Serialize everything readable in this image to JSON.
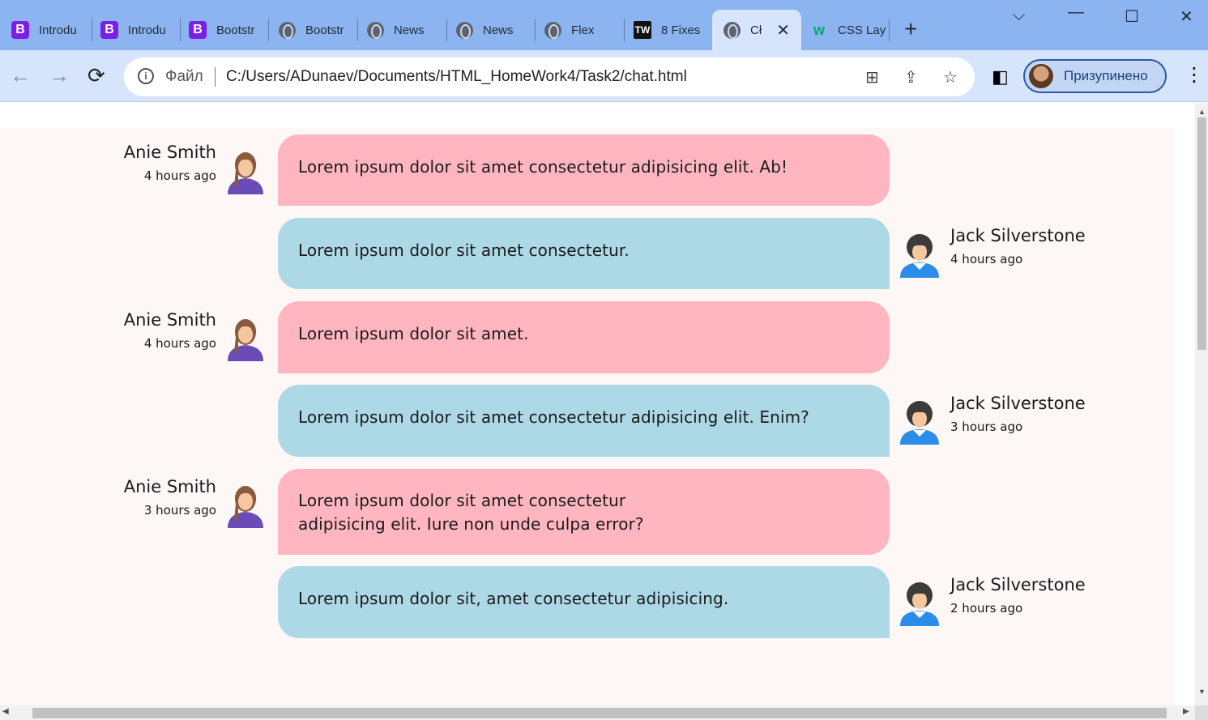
{
  "browser": {
    "tabs": [
      {
        "label": "Introdu",
        "icon": "bootstrap-icon"
      },
      {
        "label": "Introdu",
        "icon": "bootstrap-icon"
      },
      {
        "label": "Bootstr",
        "icon": "bootstrap-icon"
      },
      {
        "label": "Bootstr",
        "icon": "globe-icon"
      },
      {
        "label": "News",
        "icon": "globe-icon"
      },
      {
        "label": "News",
        "icon": "globe-icon"
      },
      {
        "label": "Flex",
        "icon": "globe-icon"
      },
      {
        "label": "8 Fixes",
        "icon": "tw-icon"
      },
      {
        "label": "Cł",
        "icon": "globe-icon",
        "active": true
      },
      {
        "label": "CSS Lay",
        "icon": "w3schools-icon"
      }
    ],
    "address": {
      "scheme_label": "Файл",
      "url": "C:/Users/ADunaev/Documents/HTML_HomeWork4/Task2/chat.html"
    },
    "profile_label": "Призупинено"
  },
  "chat": {
    "messages": [
      {
        "side": "left",
        "author": "Anie Smith",
        "time": "4 hours ago",
        "text": "Lorem ipsum dolor sit amet consectetur adipisicing elit. Ab!"
      },
      {
        "side": "right",
        "author": "Jack Silverstone",
        "time": "4 hours ago",
        "text": "Lorem ipsum dolor sit amet consectetur."
      },
      {
        "side": "left",
        "author": "Anie Smith",
        "time": "4 hours ago",
        "text": "Lorem ipsum dolor sit amet."
      },
      {
        "side": "right",
        "author": "Jack Silverstone",
        "time": "3 hours ago",
        "text": "Lorem ipsum dolor sit amet consectetur adipisicing elit. Enim?"
      },
      {
        "side": "left",
        "author": "Anie Smith",
        "time": "3 hours ago",
        "text_lines": [
          "Lorem ipsum dolor sit amet consectetur",
          "adipisicing elit. Iure non unde culpa error?"
        ]
      },
      {
        "side": "right",
        "author": "Jack Silverstone",
        "time": "2 hours ago",
        "text": "Lorem ipsum dolor sit, amet consectetur adipisicing."
      }
    ]
  },
  "colors": {
    "left_bubble": "#ffb6c1",
    "right_bubble": "#add8e6",
    "chat_background": "#fdf7f6",
    "tabstrip": "#8cb4f0"
  }
}
